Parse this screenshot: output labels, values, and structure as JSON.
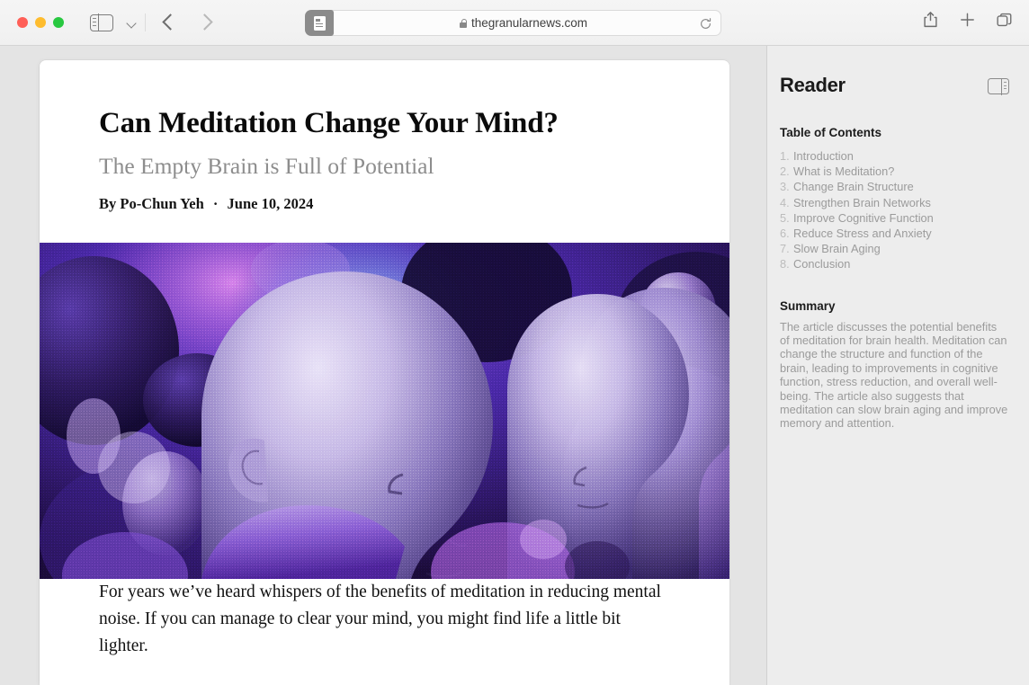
{
  "window": {
    "traffic_lights": [
      {
        "name": "close",
        "color": "#ff5f57"
      },
      {
        "name": "minimize",
        "color": "#febc2e"
      },
      {
        "name": "maximize",
        "color": "#28c840"
      }
    ]
  },
  "toolbar": {
    "sidebar_toggle_icon": "sidebar-left-icon",
    "sidebar_dropdown_icon": "chevron-down-icon",
    "back_icon": "chevron-left-icon",
    "forward_icon": "chevron-right-icon",
    "reader_button_icon": "reader-view-icon",
    "lock_icon": "lock-icon",
    "url": "thegranularnews.com",
    "url_placeholder": "Search or enter website name",
    "reload_icon": "reload-icon",
    "share_icon": "share-icon",
    "new_tab_icon": "plus-icon",
    "tab_overview_icon": "tab-overview-icon"
  },
  "article": {
    "title": "Can Meditation Change Your Mind?",
    "subtitle": "The Empty Brain is Full of Potential",
    "byline_author": "By Po-Chun Yeh",
    "byline_separator": "·",
    "byline_date": "June 10, 2024",
    "hero_alt": "Abstract grainy purple render of layered human head profiles and spheres",
    "body_paragraph": "For years we’ve heard whispers of the benefits of meditation in reducing mental noise. If you can manage to clear your mind, you might find life a little bit lighter."
  },
  "sidebar": {
    "title": "Reader",
    "panel_toggle_icon": "sidebar-right-icon",
    "toc_heading": "Table of Contents",
    "toc": [
      {
        "num": "1.",
        "label": "Introduction"
      },
      {
        "num": "2.",
        "label": "What is Meditation?"
      },
      {
        "num": "3.",
        "label": "Change Brain Structure"
      },
      {
        "num": "4.",
        "label": "Strengthen Brain Networks"
      },
      {
        "num": "5.",
        "label": "Improve Cognitive Function"
      },
      {
        "num": "6.",
        "label": "Reduce Stress and Anxiety"
      },
      {
        "num": "7.",
        "label": "Slow Brain Aging"
      },
      {
        "num": "8.",
        "label": "Conclusion"
      }
    ],
    "summary_heading": "Summary",
    "summary_body": "The article discusses the potential benefits of meditation for brain health. Meditation can change the structure and function of the brain, leading to improvements in cognitive function, stress reduction, and overall well-being. The article also suggests that meditation can slow brain aging and improve memory and attention."
  },
  "colors": {
    "toolbar_bg": "#f2f2f2",
    "content_bg": "#e4e4e4",
    "sidebar_bg": "#ededed",
    "page_bg": "#ffffff",
    "muted_text": "#9b9b9b",
    "reader_active": "#8b8b8b"
  }
}
